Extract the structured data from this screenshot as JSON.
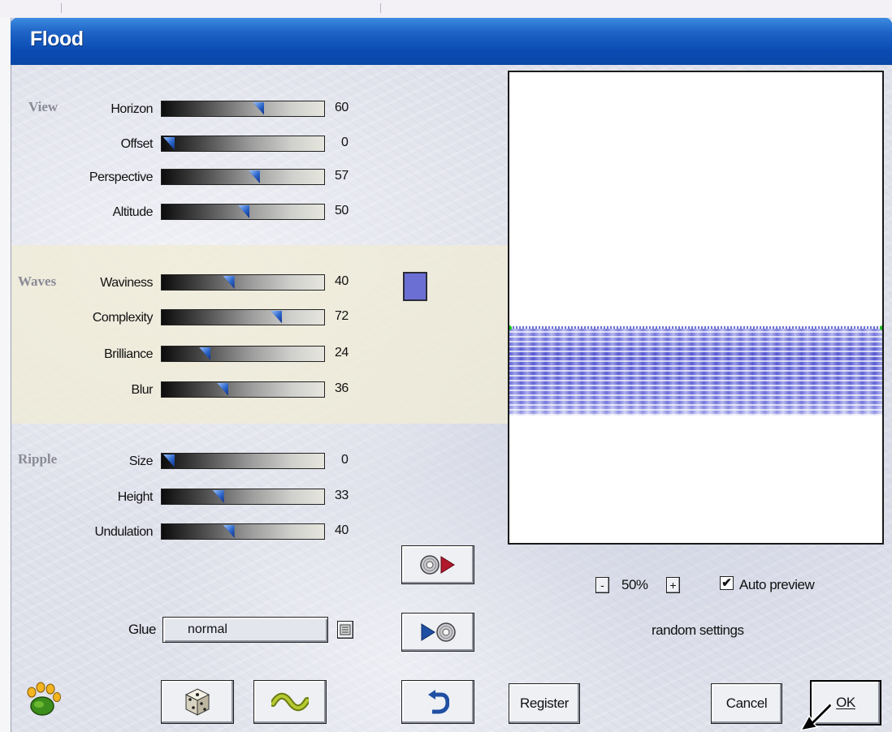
{
  "window": {
    "title": "Flood"
  },
  "groups": [
    {
      "label": "View",
      "rows": [
        {
          "label": "Horizon",
          "value": "60",
          "level": 60
        },
        {
          "label": "Offset",
          "value": "0",
          "level": 0
        },
        {
          "label": "Perspective",
          "value": "57",
          "level": 57
        },
        {
          "label": "Altitude",
          "value": "50",
          "level": 50
        }
      ]
    },
    {
      "label": "Waves",
      "rows": [
        {
          "label": "Waviness",
          "value": "40",
          "level": 40
        },
        {
          "label": "Complexity",
          "value": "72",
          "level": 72
        },
        {
          "label": "Brilliance",
          "value": "24",
          "level": 24
        },
        {
          "label": "Blur",
          "value": "36",
          "level": 36
        }
      ]
    },
    {
      "label": "Ripple",
      "rows": [
        {
          "label": "Size",
          "value": "0",
          "level": 0
        },
        {
          "label": "Height",
          "value": "33",
          "level": 33
        },
        {
          "label": "Undulation",
          "value": "40",
          "level": 40
        }
      ]
    }
  ],
  "wave_color": "#6b6fd4",
  "glue": {
    "label": "Glue",
    "value": "normal"
  },
  "zoom": {
    "minus": "-",
    "value": "50%",
    "plus": "+"
  },
  "auto_preview": {
    "label": "Auto preview",
    "checked": true,
    "mark": "✔"
  },
  "random_settings": {
    "label": "random settings"
  },
  "buttons": {
    "register": "Register",
    "cancel": "Cancel",
    "ok": "OK"
  },
  "icons": {
    "load": "disk-load-icon",
    "save": "disk-save-icon",
    "reset": "undo-arrow-icon",
    "randomize": "dice-icon",
    "wave": "wave-icon",
    "logo": "frog-foot-logo-icon"
  }
}
